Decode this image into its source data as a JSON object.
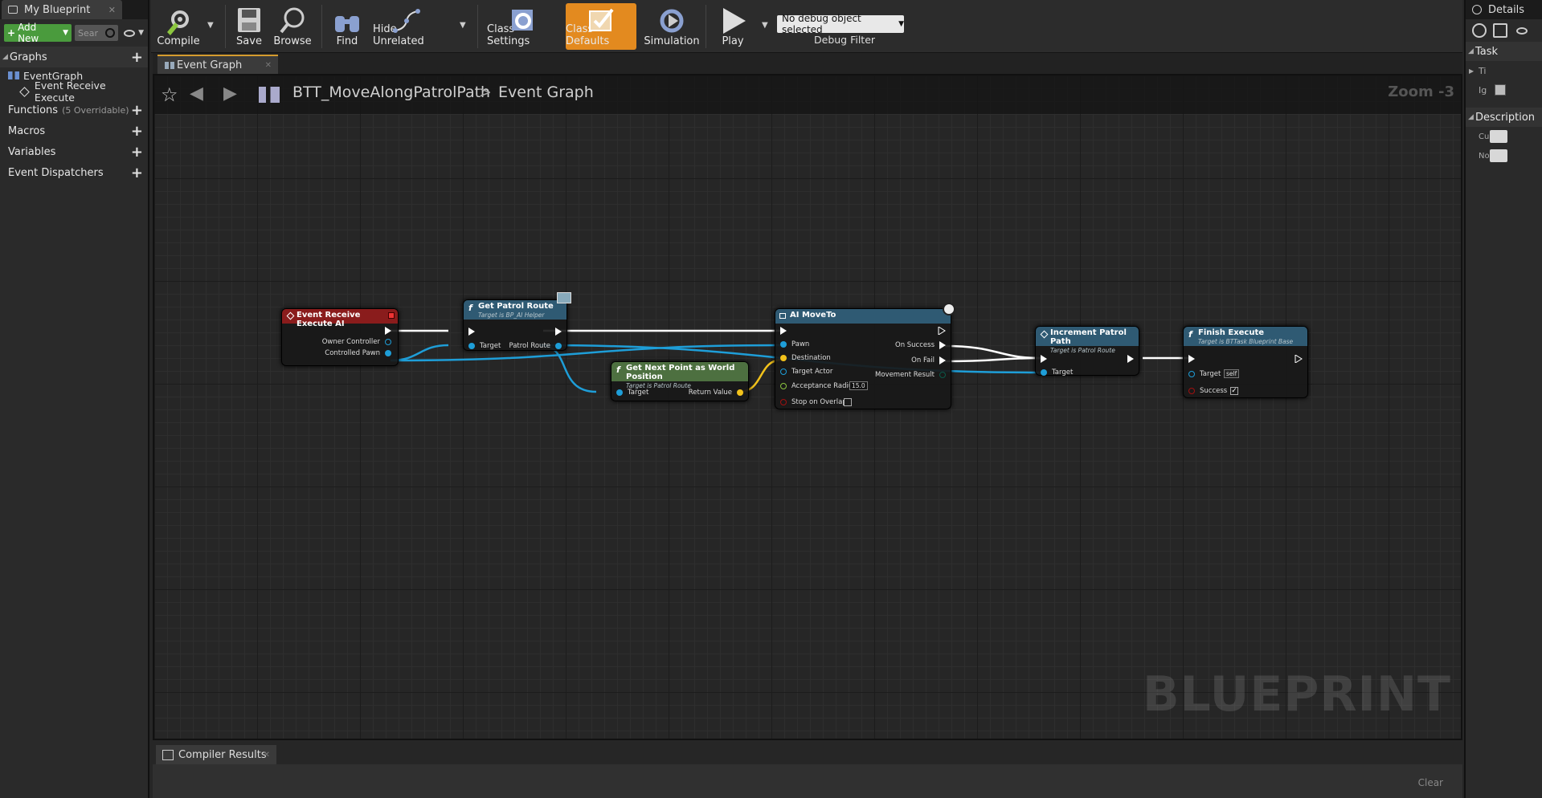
{
  "left_panel": {
    "tab_label": "My Blueprint",
    "add_new_label": "Add New",
    "search_placeholder": "Sear",
    "sections": {
      "graphs": "Graphs",
      "functions": "Functions",
      "functions_sub": "(5 Overridable)",
      "macros": "Macros",
      "variables": "Variables",
      "dispatchers": "Event Dispatchers"
    },
    "graph_items": [
      "EventGraph",
      "Event Receive Execute"
    ]
  },
  "toolbar": {
    "compile": "Compile",
    "save": "Save",
    "browse": "Browse",
    "find": "Find",
    "hide_unrelated": "Hide Unrelated",
    "class_settings": "Class Settings",
    "class_defaults": "Class Defaults",
    "simulation": "Simulation",
    "play": "Play",
    "debug_select": "No debug object selected",
    "debug_filter": "Debug Filter"
  },
  "graph_tab": "Event Graph",
  "breadcrumb": {
    "blueprint": "BTT_MoveAlongPatrolPath",
    "separator": ">",
    "graph": "Event Graph",
    "zoom": "Zoom -3"
  },
  "watermark": "BLUEPRINT",
  "nodes": {
    "event": {
      "title": "Event Receive Execute AI",
      "pins": [
        "Owner Controller",
        "Controlled Pawn"
      ]
    },
    "get_patrol_route": {
      "title": "Get Patrol Route",
      "subtitle": "Target is BP_AI Helper",
      "pins": [
        "Target",
        "Patrol Route"
      ]
    },
    "get_next_point": {
      "title": "Get Next Point as World Position",
      "subtitle": "Target is Patrol Route",
      "pins": [
        "Target",
        "Return Value"
      ]
    },
    "ai_move_to": {
      "title": "AI MoveTo",
      "pins": [
        "Pawn",
        "Destination",
        "Target Actor",
        "Acceptance Radius",
        "Stop on Overlap",
        "On Success",
        "On Fail",
        "Movement Result"
      ],
      "acceptance_radius": "15.0"
    },
    "increment": {
      "title": "Increment Patrol Path",
      "subtitle": "Target is Patrol Route",
      "pins": [
        "Target"
      ]
    },
    "finish": {
      "title": "Finish Execute",
      "subtitle": "Target is BTTask Blueprint Base",
      "pins": [
        "Target",
        "Success"
      ],
      "target_value": "self"
    }
  },
  "compiler": {
    "tab": "Compiler Results",
    "clear": "Clear"
  },
  "details": {
    "tab": "Details",
    "task_section": "Task",
    "task_rows": [
      "Ti",
      "Ig"
    ],
    "desc_section": "Description",
    "desc_rows": [
      "Cu",
      "No"
    ]
  },
  "colors": {
    "accent_orange": "#e38a1f",
    "event_header": "#8a1c1c",
    "function_header": "#2f5a73",
    "pure_header": "#4d7040",
    "exec_wire": "#ffffff",
    "object_wire": "#1e9ed8",
    "vector_wire": "#f2c21b"
  }
}
